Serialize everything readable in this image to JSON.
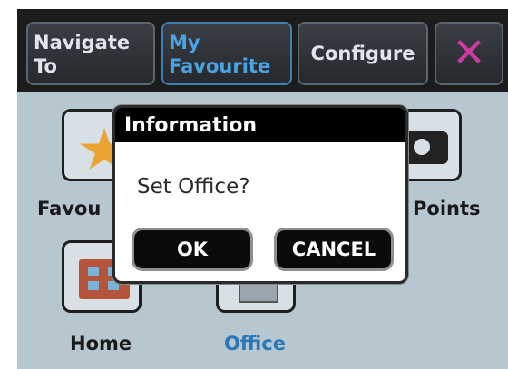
{
  "tabs": {
    "navigate_to": "Navigate To",
    "my_favourite": "My Favourite",
    "configure": "Configure",
    "close_icon": "x-icon"
  },
  "menu": {
    "favourites_label": "Favou",
    "points_label": "Points",
    "home_label": "Home",
    "office_label": "Office"
  },
  "dialog": {
    "title": "Information",
    "message": "Set Office?",
    "ok": "OK",
    "cancel": "CANCEL"
  },
  "colors": {
    "active_tab": "#4aa3e3",
    "close_x": "#d23aa3",
    "background": "#b7c7cf"
  }
}
